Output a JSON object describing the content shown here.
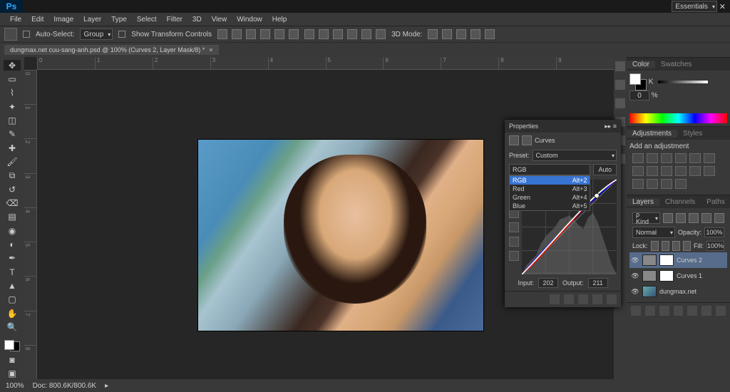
{
  "app": {
    "logo": "Ps"
  },
  "window_controls": {
    "min": "—",
    "max": "❐",
    "close": "✕"
  },
  "menu": [
    "File",
    "Edit",
    "Image",
    "Layer",
    "Type",
    "Select",
    "Filter",
    "3D",
    "View",
    "Window",
    "Help"
  ],
  "options": {
    "auto_select": "Auto-Select:",
    "group": "Group",
    "show_transform": "Show Transform Controls",
    "mode_3d": "3D Mode:"
  },
  "workspace": "Essentials",
  "doc_tab": {
    "title": "dungmax.net cuu-sang-anh.psd @ 100% (Curves 2, Layer Mask/8) *",
    "close": "×"
  },
  "ruler_h": [
    "0",
    "1",
    "2",
    "3",
    "4",
    "5",
    "6",
    "7",
    "8",
    "9"
  ],
  "ruler_v": [
    "0",
    "1",
    "2",
    "3",
    "4",
    "5",
    "6",
    "7",
    "8"
  ],
  "status": {
    "zoom": "100%",
    "doc": "Doc: 800.6K/800.6K"
  },
  "color_panel": {
    "tabs": [
      "Color",
      "Swatches"
    ],
    "k_label": "K",
    "k_value": "0",
    "pct": "%"
  },
  "adjustments_panel": {
    "tabs": [
      "Adjustments",
      "Styles"
    ],
    "title": "Add an adjustment"
  },
  "layers_panel": {
    "tabs": [
      "Layers",
      "Channels",
      "Paths"
    ],
    "kind_label": "ρ Kind",
    "blend": "Normal",
    "opacity_label": "Opacity:",
    "opacity_value": "100%",
    "lock_label": "Lock:",
    "fill_label": "Fill:",
    "fill_value": "100%",
    "layers": [
      {
        "name": "Curves 2",
        "selected": true,
        "visible": true,
        "is_adjustment": true
      },
      {
        "name": "Curves 1",
        "selected": false,
        "visible": true,
        "is_adjustment": true
      },
      {
        "name": "dungmax.net",
        "selected": false,
        "visible": true,
        "is_adjustment": false
      }
    ]
  },
  "properties": {
    "title": "Properties",
    "type_label": "Curves",
    "preset_label": "Preset:",
    "preset_value": "Custom",
    "channel_value": "RGB",
    "channel_options": [
      {
        "label": "RGB",
        "shortcut": "Alt+2",
        "selected": true
      },
      {
        "label": "Red",
        "shortcut": "Alt+3",
        "selected": false
      },
      {
        "label": "Green",
        "shortcut": "Alt+4",
        "selected": false
      },
      {
        "label": "Blue",
        "shortcut": "Alt+5",
        "selected": false
      }
    ],
    "auto": "Auto",
    "input_label": "Input:",
    "input_value": "202",
    "output_label": "Output:",
    "output_value": "211"
  }
}
